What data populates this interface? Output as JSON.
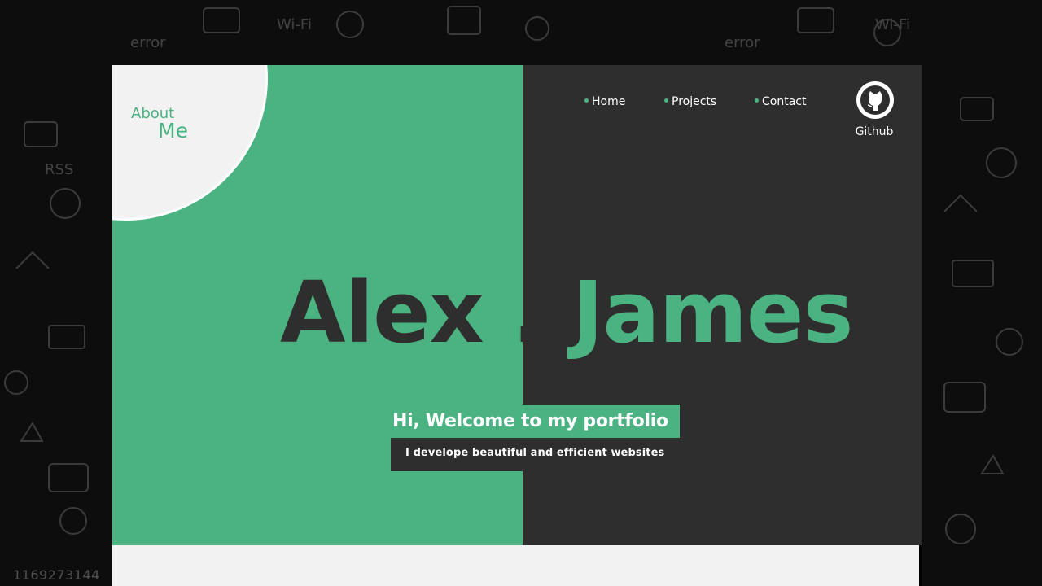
{
  "about": {
    "word1": "About",
    "word2": "Me"
  },
  "nav": {
    "items": [
      {
        "label": "Home"
      },
      {
        "label": "Projects"
      },
      {
        "label": "Contact"
      }
    ]
  },
  "github": {
    "label": "Github",
    "icon": "github-octocat-icon"
  },
  "hero": {
    "first_name": "Alex .",
    "last_name": "James",
    "welcome": "Hi, Welcome to my portfolio",
    "tagline": "I develope beautiful and efficient websites"
  },
  "background": {
    "watermark": "1169273144"
  },
  "colors": {
    "accent": "#4bb382",
    "dark": "#2e2e2e",
    "light": "#f2f2f2",
    "background": "#0d0d0d"
  }
}
